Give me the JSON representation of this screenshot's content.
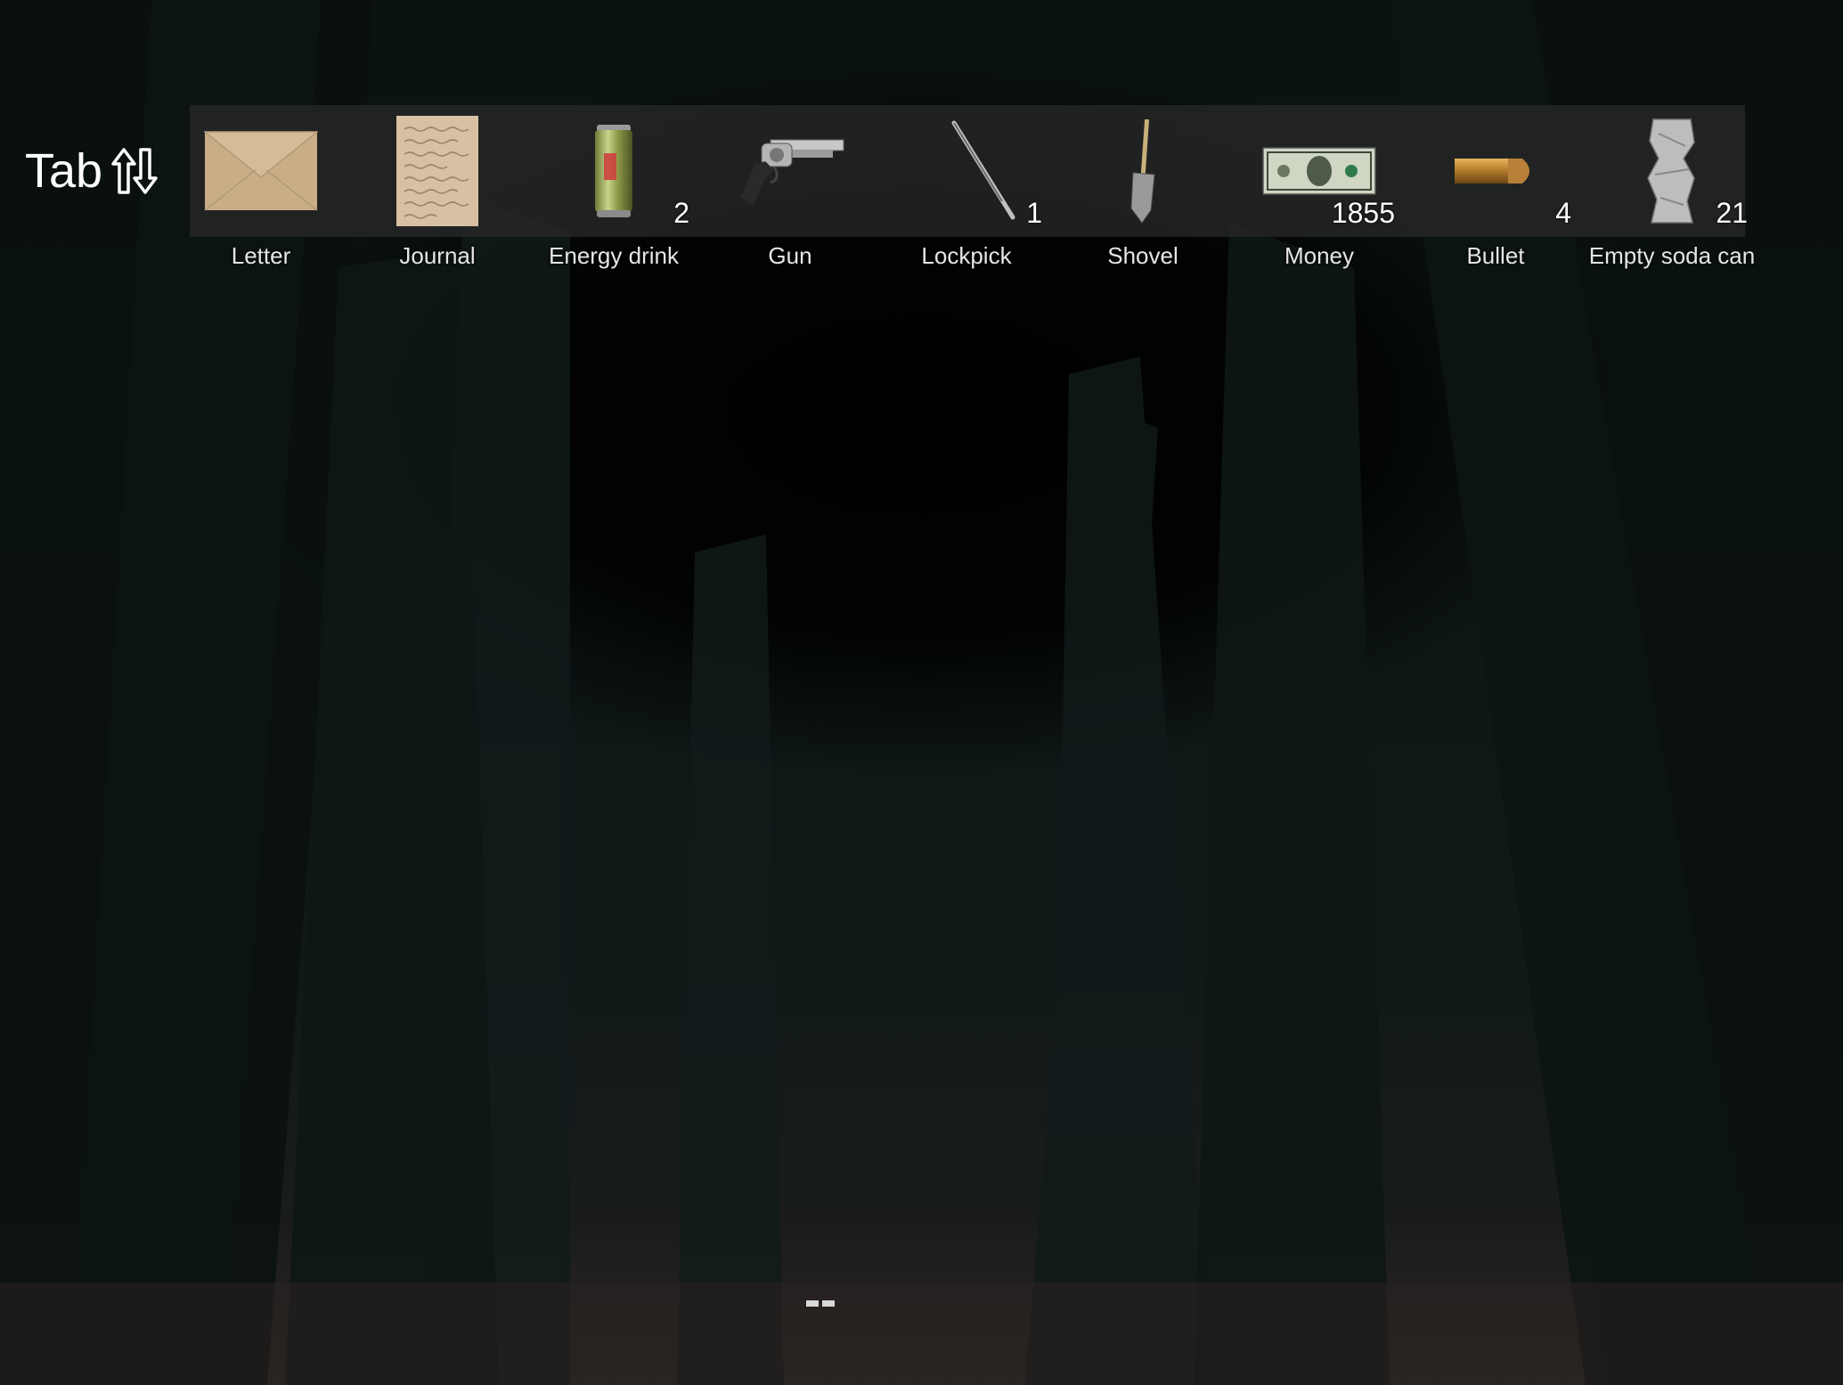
{
  "hud": {
    "tab_hint": {
      "key_label": "Tab",
      "icon": "up-down-arrows-icon"
    },
    "inventory": [
      {
        "id": "letter",
        "label": "Letter",
        "count": "",
        "icon": "envelope-icon"
      },
      {
        "id": "journal",
        "label": "Journal",
        "count": "",
        "icon": "journal-page-icon"
      },
      {
        "id": "energy-drink",
        "label": "Energy drink",
        "count": "2",
        "icon": "energy-drink-can-icon"
      },
      {
        "id": "gun",
        "label": "Gun",
        "count": "",
        "icon": "revolver-icon"
      },
      {
        "id": "lockpick",
        "label": "Lockpick",
        "count": "1",
        "icon": "lockpick-icon"
      },
      {
        "id": "shovel",
        "label": "Shovel",
        "count": "",
        "icon": "shovel-icon"
      },
      {
        "id": "money",
        "label": "Money",
        "count": "1855",
        "icon": "dollar-bill-icon"
      },
      {
        "id": "bullet",
        "label": "Bullet",
        "count": "4",
        "icon": "bullet-icon"
      },
      {
        "id": "empty-soda-can",
        "label": "Empty soda can",
        "count": "21",
        "icon": "crushed-can-icon"
      }
    ]
  },
  "colors": {
    "bar_bg": "#2a2a2a",
    "text": "#ffffff",
    "night_sky": "#000000",
    "forest": "#0f1717"
  }
}
